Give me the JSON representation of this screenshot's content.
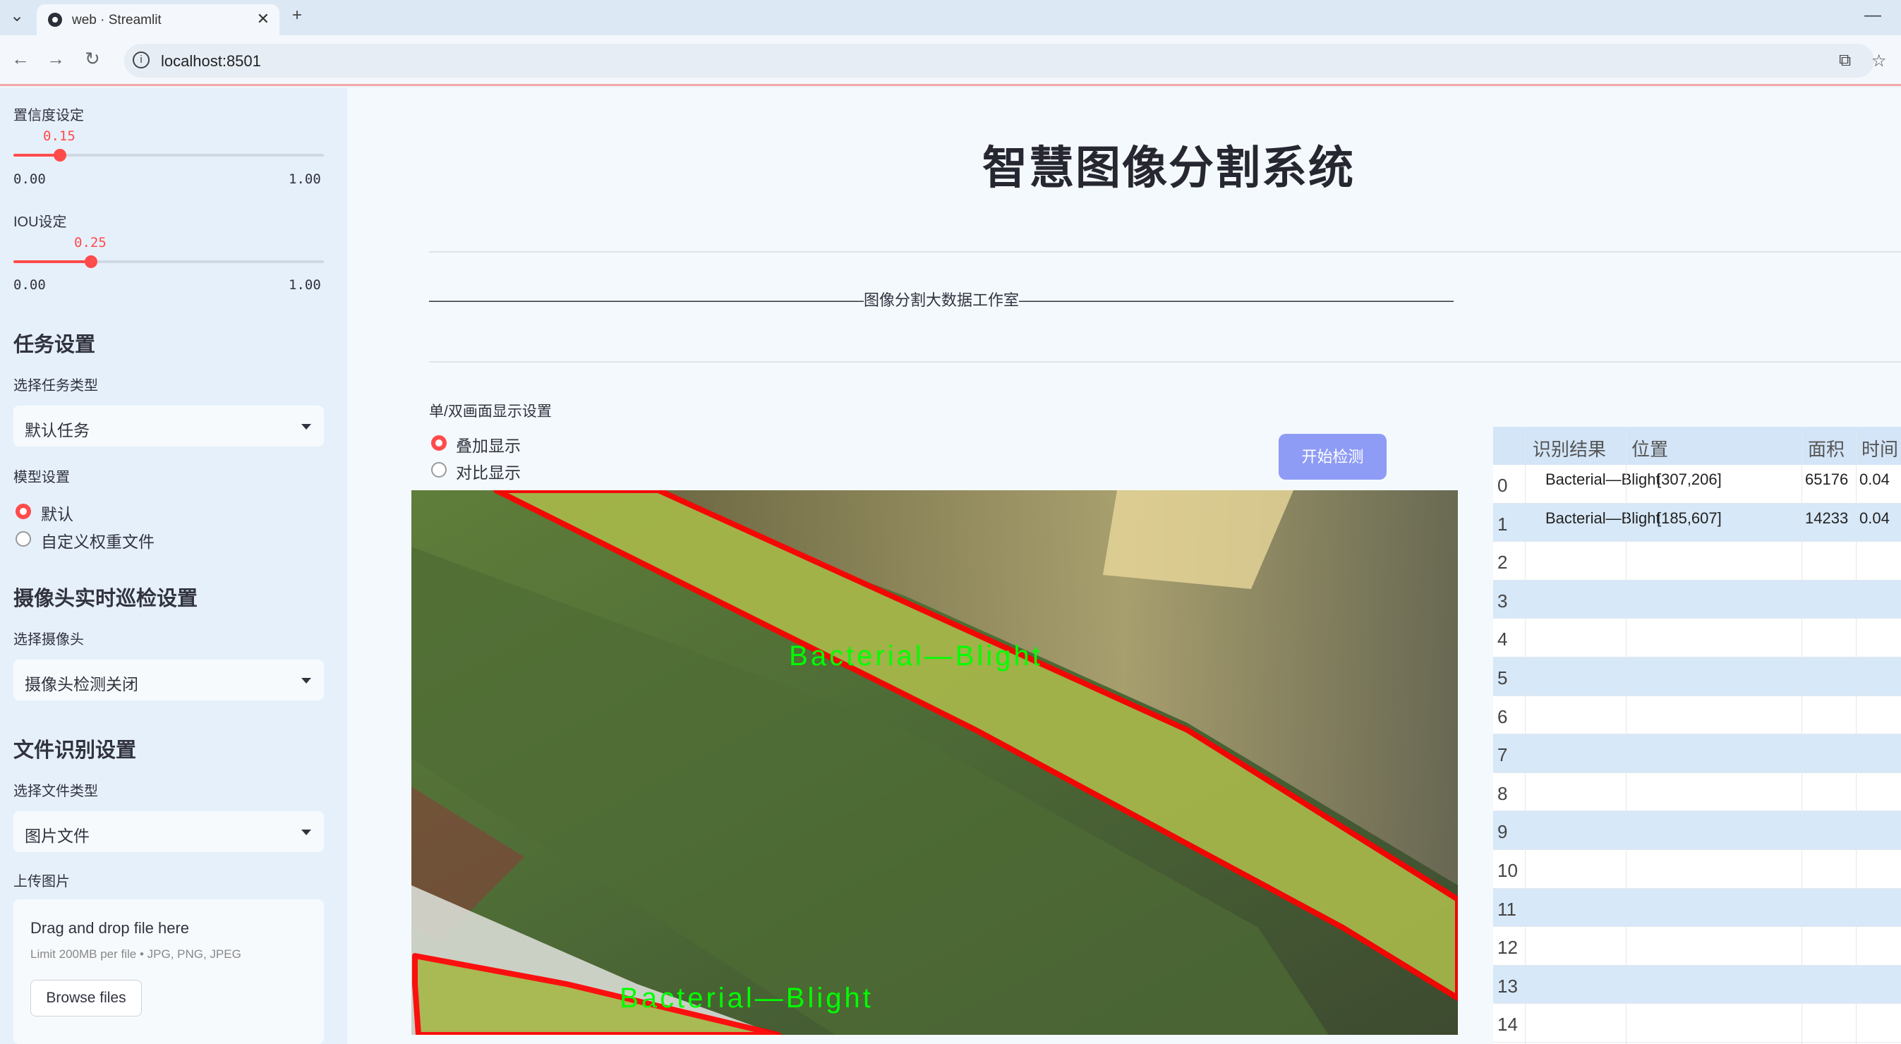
{
  "browser": {
    "tab_title": "web · Streamlit",
    "url": "localhost:8501"
  },
  "sidebar": {
    "confidence": {
      "label": "置信度设定",
      "value": "0.15",
      "min": "0.00",
      "max": "1.00",
      "fraction": 0.15
    },
    "iou": {
      "label": "IOU设定",
      "value": "0.25",
      "min": "0.00",
      "max": "1.00",
      "fraction": 0.25
    },
    "task_heading": "任务设置",
    "task_type_label": "选择任务类型",
    "task_type_value": "默认任务",
    "model_label": "模型设置",
    "model_options": [
      "默认",
      "自定义权重文件"
    ],
    "model_selected": 0,
    "camera_heading": "摄像头实时巡检设置",
    "camera_label": "选择摄像头",
    "camera_value": "摄像头检测关闭",
    "file_heading": "文件识别设置",
    "file_type_label": "选择文件类型",
    "file_type_value": "图片文件",
    "upload_label": "上传图片",
    "uploader": {
      "drag_text": "Drag and drop file here",
      "limit_text": "Limit 200MB per file • JPG, PNG, JPEG",
      "browse_label": "Browse files"
    }
  },
  "main": {
    "title": "智慧图像分割系统",
    "studio_line": "————————————————————————————图像分割大数据工作室————————————————————————————",
    "display_label": "单/双画面显示设置",
    "display_options": [
      "叠加显示",
      "对比显示"
    ],
    "display_selected": 0,
    "start_button": "开始检测",
    "image": {
      "detections": [
        "Bacterial—Blight",
        "Bacterial—Blight"
      ]
    },
    "table": {
      "columns": [
        "识别结果",
        "位置",
        "面积",
        "时间"
      ],
      "rows": [
        {
          "index": "0",
          "result": "Bacterial—Blight",
          "position": "[307,206]",
          "area": "65176",
          "time": "0.04"
        },
        {
          "index": "1",
          "result": "Bacterial—Blight",
          "position": "[185,607]",
          "area": "14233",
          "time": "0.04"
        },
        {
          "index": "2"
        },
        {
          "index": "3"
        },
        {
          "index": "4"
        },
        {
          "index": "5"
        },
        {
          "index": "6"
        },
        {
          "index": "7"
        },
        {
          "index": "8"
        },
        {
          "index": "9"
        },
        {
          "index": "10"
        },
        {
          "index": "11"
        },
        {
          "index": "12"
        },
        {
          "index": "13"
        },
        {
          "index": "14"
        }
      ]
    }
  },
  "colors": {
    "accent": "#ff4b4b",
    "button": "#8f9cf5",
    "polygon": "#ff0000",
    "label": "#00ff00"
  }
}
